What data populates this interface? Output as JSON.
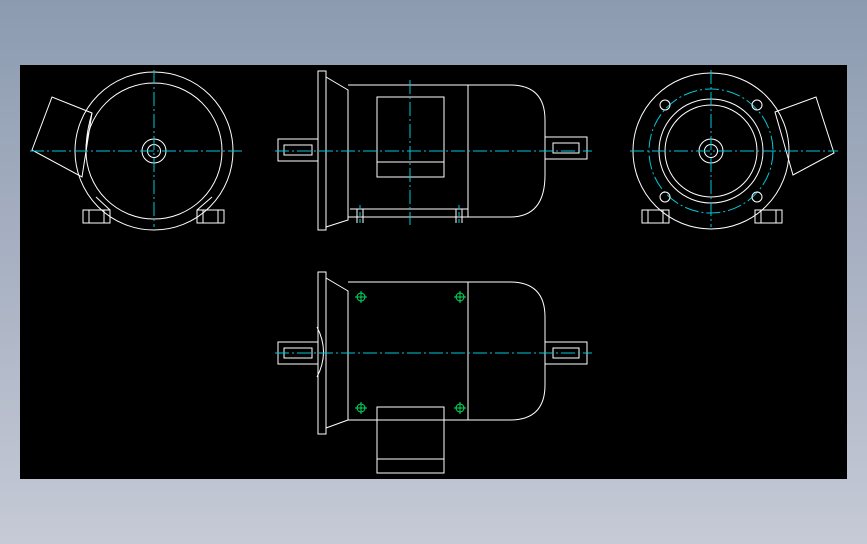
{
  "app": {
    "title": "",
    "background_colors": [
      "#8c9bb0",
      "#c6cad6"
    ],
    "canvas_color": "#000000"
  },
  "drawing": {
    "subject": "electric motor",
    "views": [
      "left-end-view",
      "front-elevation",
      "right-end-view",
      "top-plan-view"
    ],
    "colors": {
      "outline": "#ffffff",
      "centerline": "#00c8d8",
      "fastener": "#00e060"
    }
  }
}
